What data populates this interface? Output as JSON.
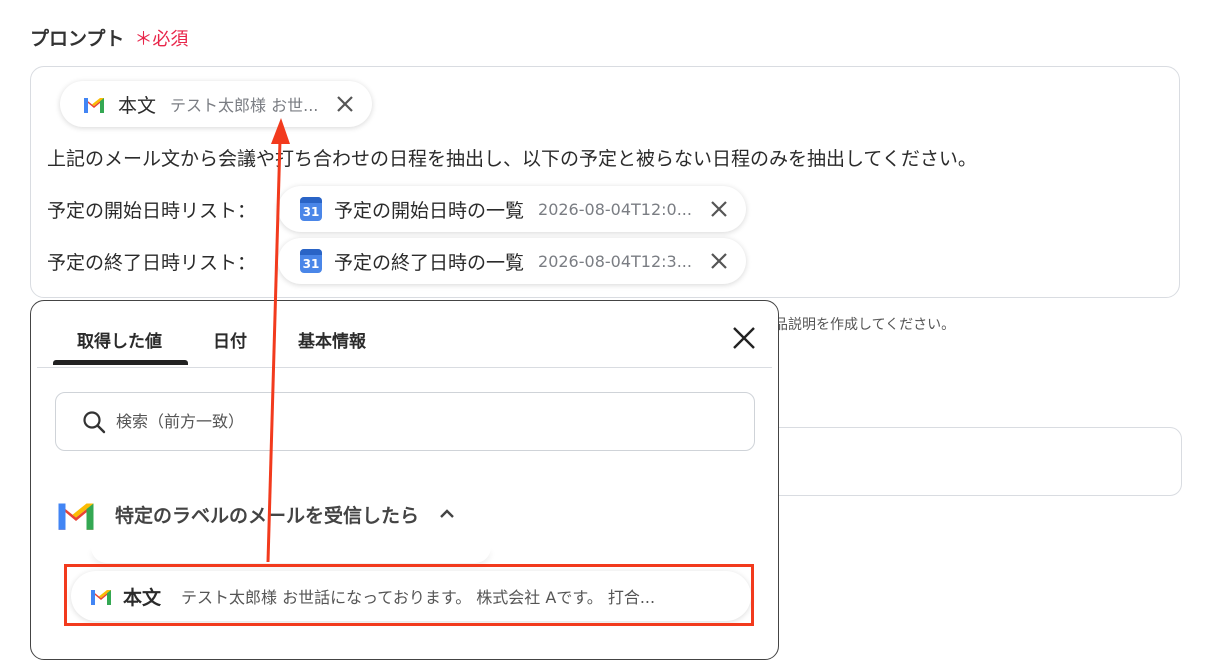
{
  "field": {
    "label": "プロンプト",
    "required": "＊必須"
  },
  "prompt": {
    "chip_body": {
      "title": "本文",
      "value": "テスト太郎様 お世...",
      "icon": "gmail-icon"
    },
    "line1": "上記のメール文から会議や打ち合わせの日程を抽出し、以下の予定と被らない日程のみを抽出してください。",
    "line2_label": "予定の開始日時リスト：",
    "chip_start": {
      "title": "予定の開始日時の一覧",
      "value": "2026-08-04T12:0...",
      "icon": "calendar-icon",
      "icon_text": "31"
    },
    "line3_label": "予定の終了日時リスト：",
    "chip_end": {
      "title": "予定の終了日時の一覧",
      "value": "2026-08-04T12:3...",
      "icon": "calendar-icon",
      "icon_text": "31"
    }
  },
  "hint_text": "品説明を作成してください。",
  "panel": {
    "tabs": [
      "取得した値",
      "日付",
      "基本情報"
    ],
    "active_tab": "取得した値",
    "search_placeholder": "検索（前方一致）",
    "group": {
      "title": "特定のラベルのメールを受信したら",
      "expanded": true
    },
    "item": {
      "title": "本文",
      "value": "テスト太郎様 お世話になっております。 株式会社 Aです。 打合..."
    }
  },
  "colors": {
    "accent_red": "#f23a1d",
    "required_red": "#e8264a",
    "calendar_blue": "#4a86e8"
  }
}
